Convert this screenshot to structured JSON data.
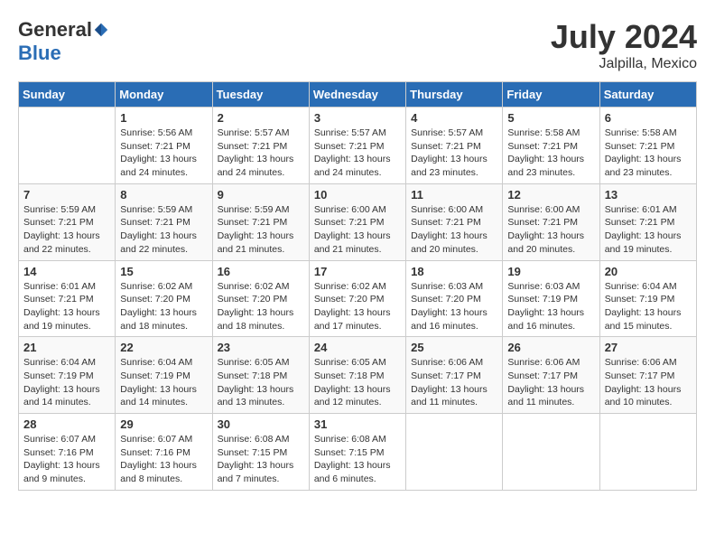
{
  "header": {
    "logo_general": "General",
    "logo_blue": "Blue",
    "title": "July 2024",
    "subtitle": "Jalpilla, Mexico"
  },
  "days_of_week": [
    "Sunday",
    "Monday",
    "Tuesday",
    "Wednesday",
    "Thursday",
    "Friday",
    "Saturday"
  ],
  "weeks": [
    [
      {
        "day": "",
        "sunrise": "",
        "sunset": "",
        "daylight": ""
      },
      {
        "day": "1",
        "sunrise": "Sunrise: 5:56 AM",
        "sunset": "Sunset: 7:21 PM",
        "daylight": "Daylight: 13 hours and 24 minutes."
      },
      {
        "day": "2",
        "sunrise": "Sunrise: 5:57 AM",
        "sunset": "Sunset: 7:21 PM",
        "daylight": "Daylight: 13 hours and 24 minutes."
      },
      {
        "day": "3",
        "sunrise": "Sunrise: 5:57 AM",
        "sunset": "Sunset: 7:21 PM",
        "daylight": "Daylight: 13 hours and 24 minutes."
      },
      {
        "day": "4",
        "sunrise": "Sunrise: 5:57 AM",
        "sunset": "Sunset: 7:21 PM",
        "daylight": "Daylight: 13 hours and 23 minutes."
      },
      {
        "day": "5",
        "sunrise": "Sunrise: 5:58 AM",
        "sunset": "Sunset: 7:21 PM",
        "daylight": "Daylight: 13 hours and 23 minutes."
      },
      {
        "day": "6",
        "sunrise": "Sunrise: 5:58 AM",
        "sunset": "Sunset: 7:21 PM",
        "daylight": "Daylight: 13 hours and 23 minutes."
      }
    ],
    [
      {
        "day": "7",
        "sunrise": "Sunrise: 5:59 AM",
        "sunset": "Sunset: 7:21 PM",
        "daylight": "Daylight: 13 hours and 22 minutes."
      },
      {
        "day": "8",
        "sunrise": "Sunrise: 5:59 AM",
        "sunset": "Sunset: 7:21 PM",
        "daylight": "Daylight: 13 hours and 22 minutes."
      },
      {
        "day": "9",
        "sunrise": "Sunrise: 5:59 AM",
        "sunset": "Sunset: 7:21 PM",
        "daylight": "Daylight: 13 hours and 21 minutes."
      },
      {
        "day": "10",
        "sunrise": "Sunrise: 6:00 AM",
        "sunset": "Sunset: 7:21 PM",
        "daylight": "Daylight: 13 hours and 21 minutes."
      },
      {
        "day": "11",
        "sunrise": "Sunrise: 6:00 AM",
        "sunset": "Sunset: 7:21 PM",
        "daylight": "Daylight: 13 hours and 20 minutes."
      },
      {
        "day": "12",
        "sunrise": "Sunrise: 6:00 AM",
        "sunset": "Sunset: 7:21 PM",
        "daylight": "Daylight: 13 hours and 20 minutes."
      },
      {
        "day": "13",
        "sunrise": "Sunrise: 6:01 AM",
        "sunset": "Sunset: 7:21 PM",
        "daylight": "Daylight: 13 hours and 19 minutes."
      }
    ],
    [
      {
        "day": "14",
        "sunrise": "Sunrise: 6:01 AM",
        "sunset": "Sunset: 7:21 PM",
        "daylight": "Daylight: 13 hours and 19 minutes."
      },
      {
        "day": "15",
        "sunrise": "Sunrise: 6:02 AM",
        "sunset": "Sunset: 7:20 PM",
        "daylight": "Daylight: 13 hours and 18 minutes."
      },
      {
        "day": "16",
        "sunrise": "Sunrise: 6:02 AM",
        "sunset": "Sunset: 7:20 PM",
        "daylight": "Daylight: 13 hours and 18 minutes."
      },
      {
        "day": "17",
        "sunrise": "Sunrise: 6:02 AM",
        "sunset": "Sunset: 7:20 PM",
        "daylight": "Daylight: 13 hours and 17 minutes."
      },
      {
        "day": "18",
        "sunrise": "Sunrise: 6:03 AM",
        "sunset": "Sunset: 7:20 PM",
        "daylight": "Daylight: 13 hours and 16 minutes."
      },
      {
        "day": "19",
        "sunrise": "Sunrise: 6:03 AM",
        "sunset": "Sunset: 7:19 PM",
        "daylight": "Daylight: 13 hours and 16 minutes."
      },
      {
        "day": "20",
        "sunrise": "Sunrise: 6:04 AM",
        "sunset": "Sunset: 7:19 PM",
        "daylight": "Daylight: 13 hours and 15 minutes."
      }
    ],
    [
      {
        "day": "21",
        "sunrise": "Sunrise: 6:04 AM",
        "sunset": "Sunset: 7:19 PM",
        "daylight": "Daylight: 13 hours and 14 minutes."
      },
      {
        "day": "22",
        "sunrise": "Sunrise: 6:04 AM",
        "sunset": "Sunset: 7:19 PM",
        "daylight": "Daylight: 13 hours and 14 minutes."
      },
      {
        "day": "23",
        "sunrise": "Sunrise: 6:05 AM",
        "sunset": "Sunset: 7:18 PM",
        "daylight": "Daylight: 13 hours and 13 minutes."
      },
      {
        "day": "24",
        "sunrise": "Sunrise: 6:05 AM",
        "sunset": "Sunset: 7:18 PM",
        "daylight": "Daylight: 13 hours and 12 minutes."
      },
      {
        "day": "25",
        "sunrise": "Sunrise: 6:06 AM",
        "sunset": "Sunset: 7:17 PM",
        "daylight": "Daylight: 13 hours and 11 minutes."
      },
      {
        "day": "26",
        "sunrise": "Sunrise: 6:06 AM",
        "sunset": "Sunset: 7:17 PM",
        "daylight": "Daylight: 13 hours and 11 minutes."
      },
      {
        "day": "27",
        "sunrise": "Sunrise: 6:06 AM",
        "sunset": "Sunset: 7:17 PM",
        "daylight": "Daylight: 13 hours and 10 minutes."
      }
    ],
    [
      {
        "day": "28",
        "sunrise": "Sunrise: 6:07 AM",
        "sunset": "Sunset: 7:16 PM",
        "daylight": "Daylight: 13 hours and 9 minutes."
      },
      {
        "day": "29",
        "sunrise": "Sunrise: 6:07 AM",
        "sunset": "Sunset: 7:16 PM",
        "daylight": "Daylight: 13 hours and 8 minutes."
      },
      {
        "day": "30",
        "sunrise": "Sunrise: 6:08 AM",
        "sunset": "Sunset: 7:15 PM",
        "daylight": "Daylight: 13 hours and 7 minutes."
      },
      {
        "day": "31",
        "sunrise": "Sunrise: 6:08 AM",
        "sunset": "Sunset: 7:15 PM",
        "daylight": "Daylight: 13 hours and 6 minutes."
      },
      {
        "day": "",
        "sunrise": "",
        "sunset": "",
        "daylight": ""
      },
      {
        "day": "",
        "sunrise": "",
        "sunset": "",
        "daylight": ""
      },
      {
        "day": "",
        "sunrise": "",
        "sunset": "",
        "daylight": ""
      }
    ]
  ]
}
